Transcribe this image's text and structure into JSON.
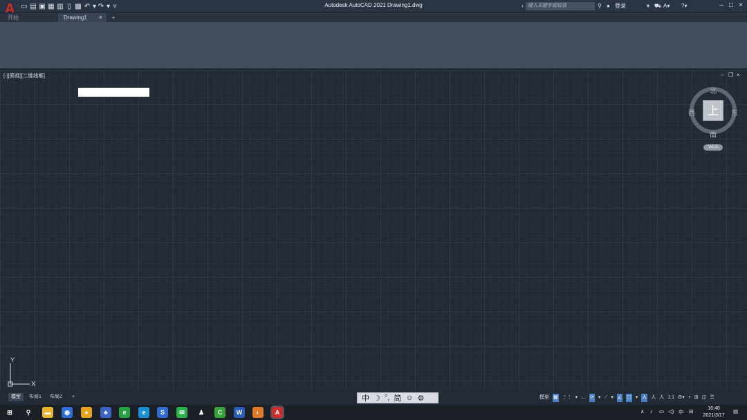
{
  "app": {
    "title": "Autodesk AutoCAD 2021    Drawing1.dwg",
    "logo_letter": "A",
    "search_placeholder": "键入关键字或短语",
    "login_label": "登录"
  },
  "tabs": {
    "start_label": "开始",
    "drawing_label": "Drawing1",
    "close_glyph": "×",
    "add_glyph": "+"
  },
  "viewport": {
    "label": "[-][俯视][二维线框]",
    "min_glyph": "–",
    "restore_glyph": "❐",
    "close_glyph": "×"
  },
  "viewcube": {
    "north": "北",
    "south": "南",
    "east": "东",
    "west": "西",
    "face": "上",
    "wcs": "WCS"
  },
  "ucs": {
    "y_label": "Y",
    "x_label": "X"
  },
  "layout_tabs": [
    "模型",
    "布局1",
    "布局2",
    "+"
  ],
  "ime": [
    "中",
    "☽",
    "°,",
    "简",
    "☺",
    "⚙"
  ],
  "status": {
    "model_label": "模型",
    "scale_label": "1:1"
  },
  "taskbar": {
    "icons": [
      {
        "name": "start-icon",
        "glyph": "⊞",
        "color": "#1b1f26"
      },
      {
        "name": "search-icon",
        "glyph": "⚲",
        "color": "#1b1f26"
      },
      {
        "name": "file-explorer-icon",
        "glyph": "▬",
        "color": "#e8b531"
      },
      {
        "name": "app1-icon",
        "glyph": "◉",
        "color": "#2d6fd6"
      },
      {
        "name": "chrome-icon",
        "glyph": "●",
        "color": "#e6a41d"
      },
      {
        "name": "app2-icon",
        "glyph": "♣",
        "color": "#3e63c2"
      },
      {
        "name": "app3-icon",
        "glyph": "e",
        "color": "#27a046"
      },
      {
        "name": "edge-icon",
        "glyph": "e",
        "color": "#1d8fd6"
      },
      {
        "name": "app4-icon",
        "glyph": "S",
        "color": "#2f6bd0"
      },
      {
        "name": "wechat-icon",
        "glyph": "✉",
        "color": "#2bb14b"
      },
      {
        "name": "qq-icon",
        "glyph": "♟",
        "color": "#1b1f26"
      },
      {
        "name": "camtasia-icon",
        "glyph": "C",
        "color": "#3aa23a"
      },
      {
        "name": "word-icon",
        "glyph": "W",
        "color": "#2a5bb7"
      },
      {
        "name": "firefox-icon",
        "glyph": "◐",
        "color": "#e27a2a"
      },
      {
        "name": "autocad-icon",
        "glyph": "A",
        "color": "#c9302c"
      }
    ],
    "ime_lang": "中",
    "time": "16:48",
    "date": "2021/3/17"
  }
}
